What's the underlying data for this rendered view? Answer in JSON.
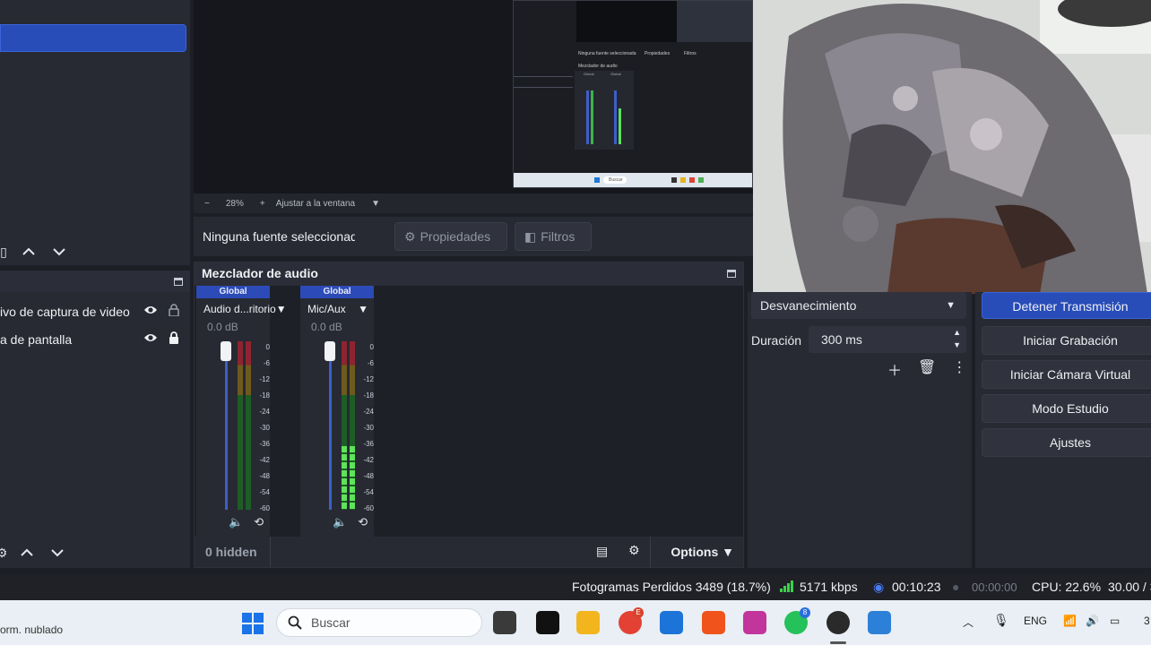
{
  "preview": {
    "zoom": "28%",
    "fit_label": "Ajustar a la ventana",
    "nested_texts": [
      "Ninguna fuente seleccionada",
      "Propiedades",
      "Filtros",
      "Mezclador de audio",
      "Global",
      "Global",
      "Buscar"
    ]
  },
  "context_bar": {
    "no_source": "Ninguna fuente seleccionad",
    "properties": "Propiedades",
    "filters": "Filtros"
  },
  "sources": {
    "items": [
      {
        "label": "ivo de captura de video"
      },
      {
        "label": "a de pantalla"
      }
    ]
  },
  "mixer": {
    "title": "Mezclador de audio",
    "channels": [
      {
        "tag": "Global",
        "name": "Audio d...ritorio",
        "db": "0.0 dB",
        "volume": 1.0,
        "level": 0.0
      },
      {
        "tag": "Global",
        "name": "Mic/Aux",
        "db": "0.0 dB",
        "volume": 1.0,
        "level": 0.38
      }
    ],
    "scale": [
      "0",
      "-6",
      "-12",
      "-18",
      "-24",
      "-30",
      "-36",
      "-42",
      "-48",
      "-54",
      "-60"
    ],
    "hidden": "0 hidden",
    "options": "Options"
  },
  "transitions": {
    "selected": "Desvanecimiento",
    "duration_label": "Duración",
    "duration_value": "300 ms"
  },
  "controls": {
    "stream": "Detener Transmisión",
    "record": "Iniciar Grabación",
    "virtual_cam": "Iniciar Cámara Virtual",
    "studio": "Modo Estudio",
    "settings": "Ajustes"
  },
  "status": {
    "dropped": "Fotogramas Perdidos 3489 (18.7%)",
    "bitrate": "5171 kbps",
    "stream_time": "00:10:23",
    "rec_time": "00:00:00",
    "cpu": "CPU: 22.6%",
    "fps": "30.00 / 3"
  },
  "taskbar": {
    "weather": "orm. nublado",
    "search_placeholder": "Buscar",
    "lang": "ENG",
    "chrome_badge": "E",
    "whatsapp_badge": "8",
    "clock_partial": "3"
  },
  "colors": {
    "accent": "#284cb8",
    "dock_bg": "#272a33",
    "meter_green": "#3bb54a",
    "meter_yellow": "#b59a2a",
    "meter_red": "#8e2430"
  }
}
